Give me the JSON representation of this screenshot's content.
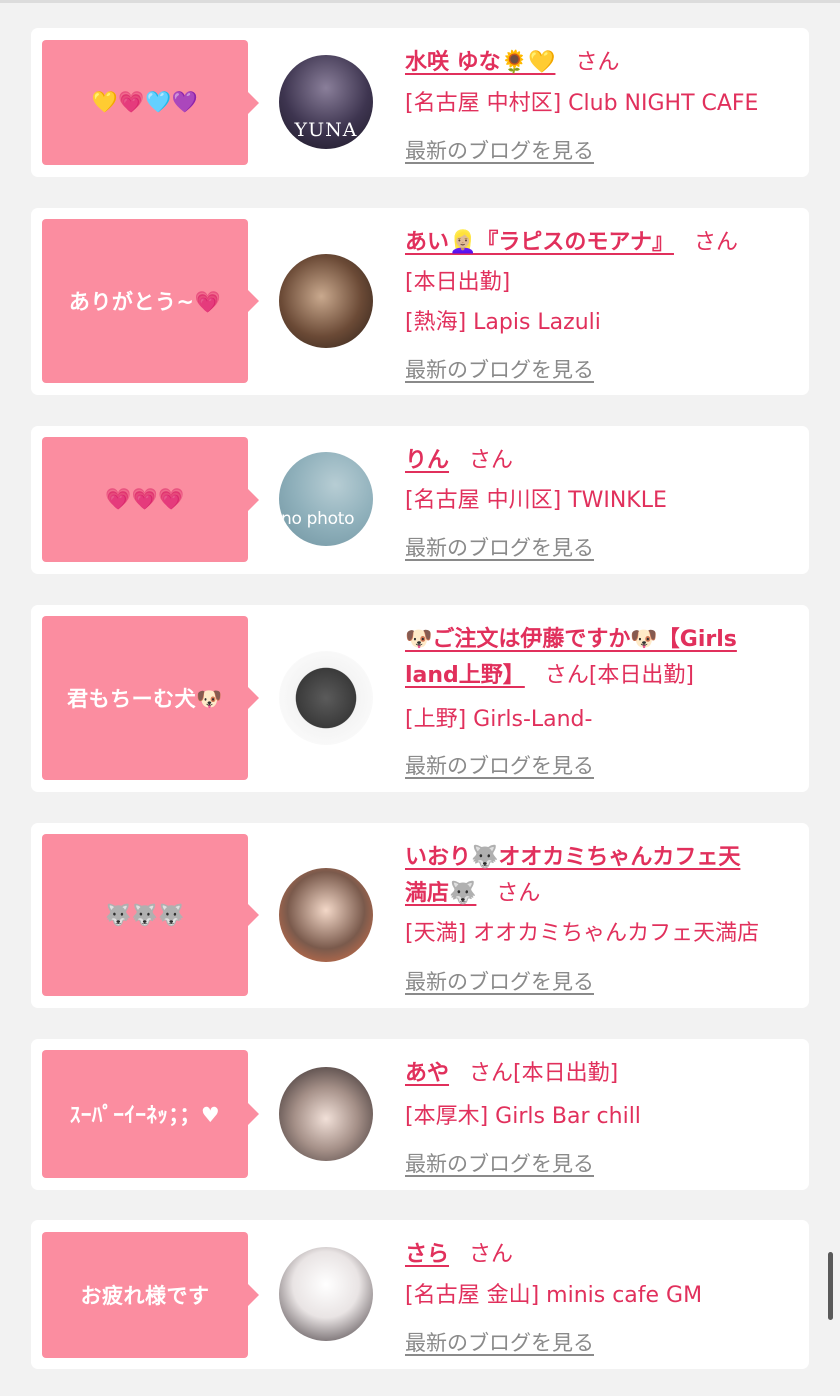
{
  "blog_link_label": "最新のブログを見る",
  "colors": {
    "bubble": "#fb8da0",
    "accent": "#e1305c",
    "link_gray": "#8a8a8a",
    "background": "#f2f2f2"
  },
  "entries": [
    {
      "message": "💛💗🩵💜",
      "name": "水咲 ゆな🌻💛",
      "san": "さん",
      "status": "",
      "location": "[名古屋 中村区] Club NIGHT CAFE",
      "avatar_text": "YUNA"
    },
    {
      "message": "ありがとう~💗",
      "name": "あい👱🏼‍♀️『ラピスのモアナ』",
      "san": "さん",
      "status": "[本日出勤]",
      "location": "[熱海] Lapis Lazuli",
      "avatar_text": ""
    },
    {
      "message": "💗💗💗",
      "name": "りん",
      "san": "さん",
      "status": "",
      "location": "[名古屋 中川区] TWINKLE",
      "avatar_text": "no photo"
    },
    {
      "message": "君もちーむ犬🐶",
      "name_line1": "🐶ご注文は伊藤ですか🐶【Girls",
      "name_line2": "land上野】",
      "san": "さん",
      "status": "[本日出勤]",
      "location": "[上野] Girls-Land-",
      "avatar_text": ""
    },
    {
      "message": "🐺🐺🐺",
      "name_line1": "いおり🐺オオカミちゃんカフェ天",
      "name_line2": "満店🐺",
      "san": "さん",
      "status": "",
      "location": "[天満] オオカミちゃんカフェ天満店",
      "avatar_text": ""
    },
    {
      "message": "ｽｰﾊﾟｰｲｰﾈｯ；；♥",
      "name": "あや",
      "san": "さん",
      "status": "[本日出勤]",
      "location": "[本厚木] Girls Bar chill",
      "avatar_text": ""
    },
    {
      "message": "お疲れ様です",
      "name": "さら",
      "san": "さん",
      "status": "",
      "location": "[名古屋 金山] minis cafe GM",
      "avatar_text": ""
    }
  ]
}
